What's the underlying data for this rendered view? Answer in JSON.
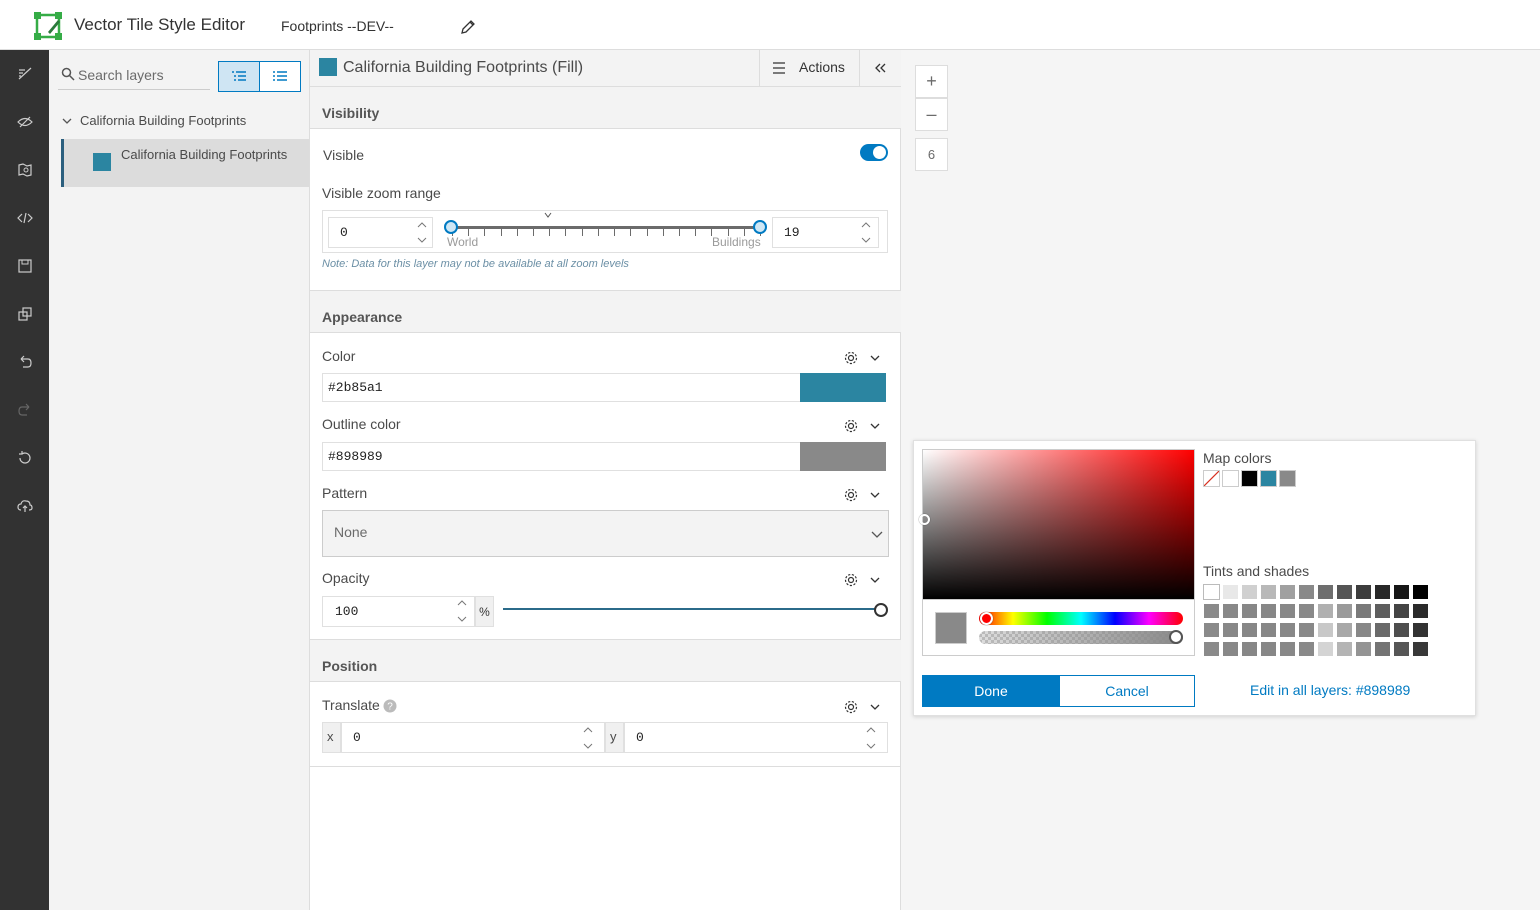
{
  "header": {
    "app_title": "Vector Tile Style Editor",
    "style_name": "Footprints --DEV--"
  },
  "rail": {
    "icons": [
      "style-icon",
      "eye-icon",
      "map-icon",
      "code-icon",
      "save-icon",
      "copy-icon",
      "undo-icon",
      "redo-icon",
      "reset-icon",
      "cloud-upload-icon"
    ]
  },
  "layers": {
    "search_placeholder": "Search layers",
    "group_label": "California Building Footprints",
    "item_label": "California Building Footprints",
    "item_color": "#2b85a1"
  },
  "panel": {
    "title": "California Building Footprints (Fill)",
    "actions_label": "Actions",
    "visibility": {
      "section_title": "Visibility",
      "visible_label": "Visible",
      "visible_on": true,
      "zoom_range_label": "Visible zoom range",
      "min_zoom": "0",
      "max_zoom": "19",
      "tick_left": "World",
      "tick_right": "Buildings",
      "note": "Note: Data for this layer may not be available at all zoom levels"
    },
    "appearance": {
      "section_title": "Appearance",
      "color_label": "Color",
      "color_value": "#2b85a1",
      "outline_label": "Outline color",
      "outline_value": "#898989",
      "pattern_label": "Pattern",
      "pattern_value": "None",
      "opacity_label": "Opacity",
      "opacity_value": "100",
      "opacity_unit": "%"
    },
    "position": {
      "section_title": "Position",
      "translate_label": "Translate",
      "x_label": "x",
      "x_value": "0",
      "y_label": "y",
      "y_value": "0"
    }
  },
  "map": {
    "zoom_in": "+",
    "zoom_out": "–",
    "zoom_level": "6"
  },
  "picker": {
    "map_colors_label": "Map colors",
    "map_colors": [
      "none",
      "#ffffff",
      "#000000",
      "#2b85a1",
      "#898989"
    ],
    "tints_label": "Tints and shades",
    "done_label": "Done",
    "cancel_label": "Cancel",
    "edit_all_label": "Edit in all layers: #898989",
    "current_color": "#898989"
  }
}
